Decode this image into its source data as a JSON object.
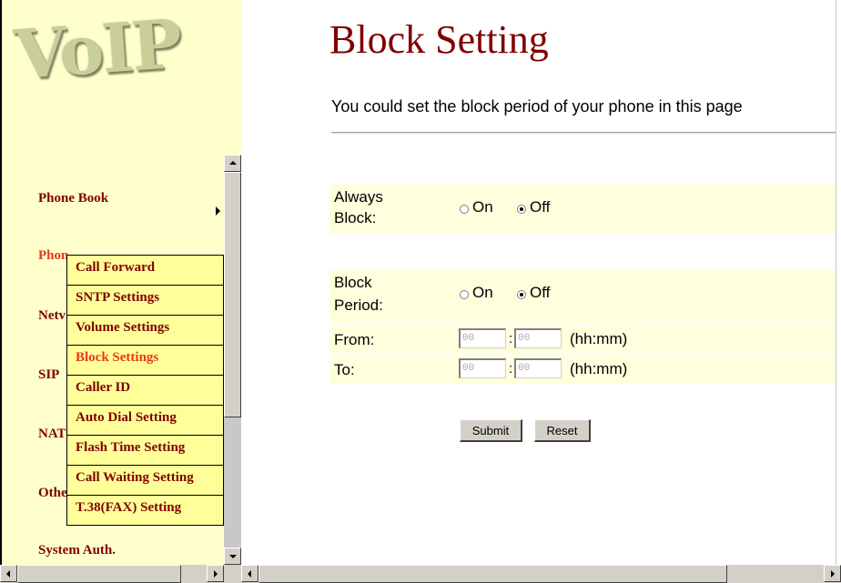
{
  "logo": {
    "text": "VoIP"
  },
  "nav": {
    "items": [
      {
        "id": "phone-book",
        "label": "Phone Book"
      },
      {
        "id": "phone-settings",
        "label": "Phone Settings"
      },
      {
        "id": "network",
        "label": "Network"
      },
      {
        "id": "sip",
        "label": "SIP"
      },
      {
        "id": "nat",
        "label": "NAT"
      },
      {
        "id": "other",
        "label": "Other"
      },
      {
        "id": "system-auth",
        "label": "System Auth."
      }
    ],
    "visible_labels": {
      "phone_book": "Phone Book",
      "phone_settings": "Phon",
      "network": "Netv",
      "sip": "SIP",
      "nat": "NAT",
      "other": "Othe",
      "system_auth": "System Auth."
    }
  },
  "submenu": {
    "items": [
      {
        "label": "Call Forward"
      },
      {
        "label": "SNTP Settings"
      },
      {
        "label": "Volume Settings"
      },
      {
        "label": "Block Settings",
        "active": true
      },
      {
        "label": "Caller ID"
      },
      {
        "label": "Auto Dial Setting"
      },
      {
        "label": "Flash Time Setting"
      },
      {
        "label": "Call Waiting Setting"
      },
      {
        "label": "T.38(FAX) Setting"
      }
    ]
  },
  "main": {
    "title": "Block Setting",
    "description": "You could set the block period of your phone in this page",
    "always_block": {
      "label_line1": "Always",
      "label_line2": "Block:",
      "on_label": "On",
      "off_label": "Off",
      "selected": "Off"
    },
    "block_period": {
      "label_line1": "Block",
      "label_line2": "Period:",
      "on_label": "On",
      "off_label": "Off",
      "selected": "Off"
    },
    "from": {
      "label": "From:",
      "hour_placeholder": "00",
      "minute_placeholder": "00",
      "separator": ":",
      "hint": "(hh:mm)"
    },
    "to": {
      "label": "To:",
      "hour_placeholder": "00",
      "minute_placeholder": "00",
      "separator": ":",
      "hint": "(hh:mm)"
    },
    "submit_label": "Submit",
    "reset_label": "Reset"
  },
  "colors": {
    "nav_bg": "#ffffcc",
    "submenu_bg": "#ffff99",
    "title": "#800000",
    "active": "#e53a1e",
    "row_bg": "#ffffdd"
  }
}
